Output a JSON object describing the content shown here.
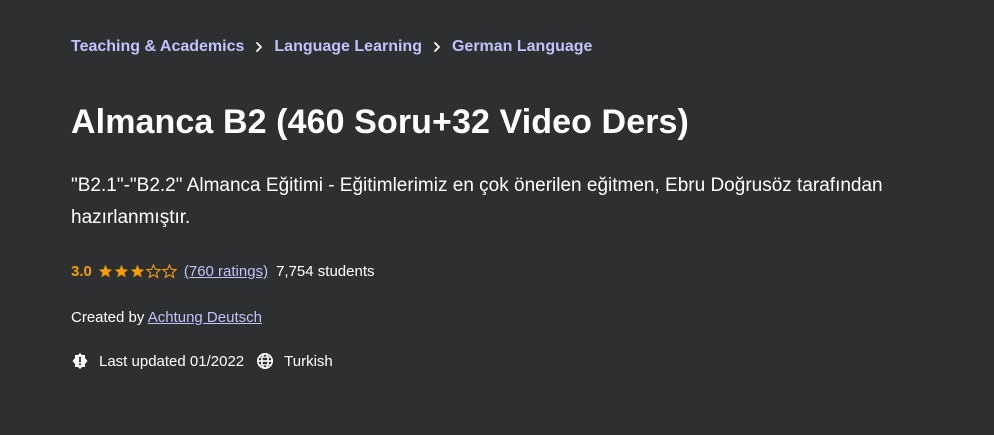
{
  "breadcrumb": {
    "items": [
      {
        "label": "Teaching & Academics"
      },
      {
        "label": "Language Learning"
      },
      {
        "label": "German Language"
      }
    ]
  },
  "course": {
    "title": "Almanca B2 (460 Soru+32 Video Ders)",
    "subtitle": "\"B2.1\"-\"B2.2\" Almanca Eğitimi - Eğitimlerimiz en çok önerilen eğitmen, Ebru Doğrusöz tarafından hazırlanmıştır."
  },
  "rating": {
    "value": "3.0",
    "stars_filled": 3,
    "stars_total": 5,
    "ratings_count_label": "(760 ratings)",
    "students_label": "7,754 students"
  },
  "instructor": {
    "prefix": "Created by",
    "name": "Achtung Deutsch"
  },
  "meta": {
    "last_updated": "Last updated 01/2022",
    "language": "Turkish",
    "updated_icon": "alert-badge-icon",
    "language_icon": "globe-icon"
  },
  "colors": {
    "background": "#2d2f31",
    "link": "#c0c4fc",
    "rating": "#f69c08",
    "text": "#ffffff"
  }
}
